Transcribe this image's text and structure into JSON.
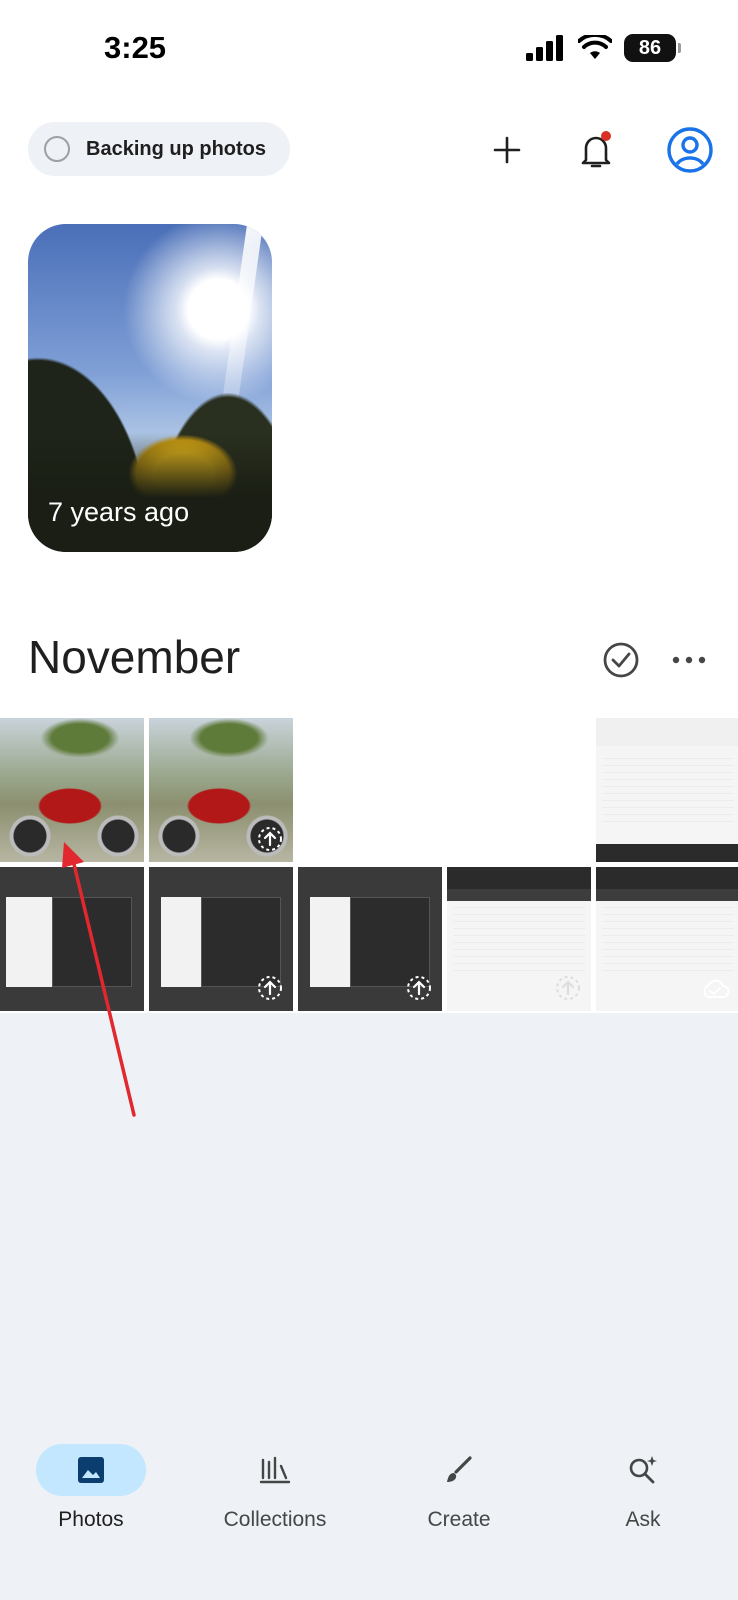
{
  "status_bar": {
    "time": "3:25",
    "battery": "86"
  },
  "header": {
    "backup_label": "Backing up photos",
    "icons": [
      "add-icon",
      "bell-icon",
      "account-icon"
    ],
    "notification_dot_color": "#d93025"
  },
  "memory": {
    "label": "7 years ago"
  },
  "section": {
    "title": "November",
    "icons": [
      "select-check-icon",
      "more-icon"
    ]
  },
  "photos": [
    {
      "kind": "motorcycle"
    },
    {
      "kind": "motorcycle",
      "status": "uploading"
    },
    {
      "kind": "blank"
    },
    {
      "kind": "blank"
    },
    {
      "kind": "spreadsheet"
    },
    {
      "kind": "spreadsheet"
    },
    {
      "kind": "dark-dialog",
      "status": "uploading"
    },
    {
      "kind": "dark-dialog",
      "status": "uploading"
    },
    {
      "kind": "spreadsheet",
      "status": "uploading"
    },
    {
      "kind": "spreadsheet",
      "status": "cloud"
    }
  ],
  "bottom_nav": {
    "items": [
      {
        "label": "Photos",
        "icon": "photo-icon",
        "active": true
      },
      {
        "label": "Collections",
        "icon": "collections-icon",
        "active": false
      },
      {
        "label": "Create",
        "icon": "brush-icon",
        "active": false
      },
      {
        "label": "Ask",
        "icon": "ask-sparkle-icon",
        "active": false
      }
    ]
  },
  "colors": {
    "accent": "#1a73e8",
    "active_nav": "#c2e7ff",
    "annotation_arrow": "#e0282e"
  }
}
